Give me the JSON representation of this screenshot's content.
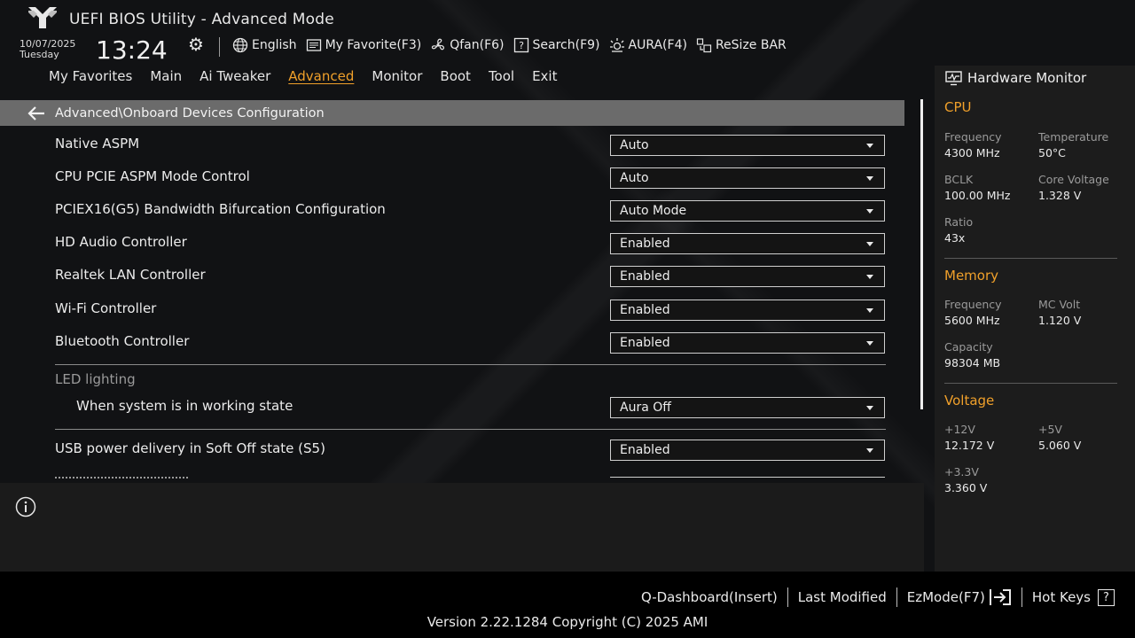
{
  "header": {
    "title": "UEFI BIOS Utility - Advanced Mode",
    "date": "10/07/2025",
    "day": "Tuesday",
    "time": "13:24",
    "tools": [
      {
        "icon": "globe-icon",
        "label": "English"
      },
      {
        "icon": "favorite-icon",
        "label": "My Favorite(F3)"
      },
      {
        "icon": "fan-icon",
        "label": "Qfan(F6)"
      },
      {
        "icon": "search-icon",
        "label": "Search(F9)"
      },
      {
        "icon": "aura-icon",
        "label": "AURA(F4)"
      },
      {
        "icon": "resize-bar-icon",
        "label": "ReSize BAR"
      }
    ]
  },
  "tabs": [
    "My Favorites",
    "Main",
    "Ai Tweaker",
    "Advanced",
    "Monitor",
    "Boot",
    "Tool",
    "Exit"
  ],
  "active_tab": "Advanced",
  "breadcrumb": "Advanced\\Onboard Devices Configuration",
  "settings": [
    {
      "label": "Native ASPM",
      "value": "Auto"
    },
    {
      "label": "CPU PCIE ASPM Mode Control",
      "value": "Auto"
    },
    {
      "label": "PCIEX16(G5) Bandwidth Bifurcation Configuration",
      "value": "Auto Mode"
    },
    {
      "label": "HD Audio Controller",
      "value": "Enabled"
    },
    {
      "label": "Realtek LAN Controller",
      "value": "Enabled"
    },
    {
      "label": "Wi-Fi Controller",
      "value": "Enabled"
    },
    {
      "label": "Bluetooth Controller",
      "value": "Enabled"
    }
  ],
  "led_section": {
    "title": "LED lighting",
    "item_label": "When system is in working state",
    "item_value": "Aura Off"
  },
  "usb_setting": {
    "label": "USB power delivery in Soft Off state (S5)",
    "value": "Enabled"
  },
  "hardware_monitor": {
    "title": "Hardware Monitor",
    "cpu": {
      "title": "CPU",
      "frequency_label": "Frequency",
      "frequency": "4300 MHz",
      "temperature_label": "Temperature",
      "temperature": "50°C",
      "bclk_label": "BCLK",
      "bclk": "100.00 MHz",
      "core_voltage_label": "Core Voltage",
      "core_voltage": "1.328 V",
      "ratio_label": "Ratio",
      "ratio": "43x"
    },
    "memory": {
      "title": "Memory",
      "frequency_label": "Frequency",
      "frequency": "5600 MHz",
      "mc_volt_label": "MC Volt",
      "mc_volt": "1.120 V",
      "capacity_label": "Capacity",
      "capacity": "98304 MB"
    },
    "voltage": {
      "title": "Voltage",
      "v12_label": "+12V",
      "v12": "12.172 V",
      "v5_label": "+5V",
      "v5": "5.060 V",
      "v33_label": "+3.3V",
      "v33": "3.360 V"
    }
  },
  "footer": {
    "q_dashboard": "Q-Dashboard(Insert)",
    "last_modified": "Last Modified",
    "ezmode": "EzMode(F7)",
    "hot_keys": "Hot Keys",
    "hot_keys_icon_text": "?",
    "version": "Version 2.22.1284 Copyright (C) 2025 AMI"
  },
  "colors": {
    "accent": "#f0a02a",
    "panel": "#1c1c1c",
    "breadcrumb": "#6b6b6b"
  }
}
